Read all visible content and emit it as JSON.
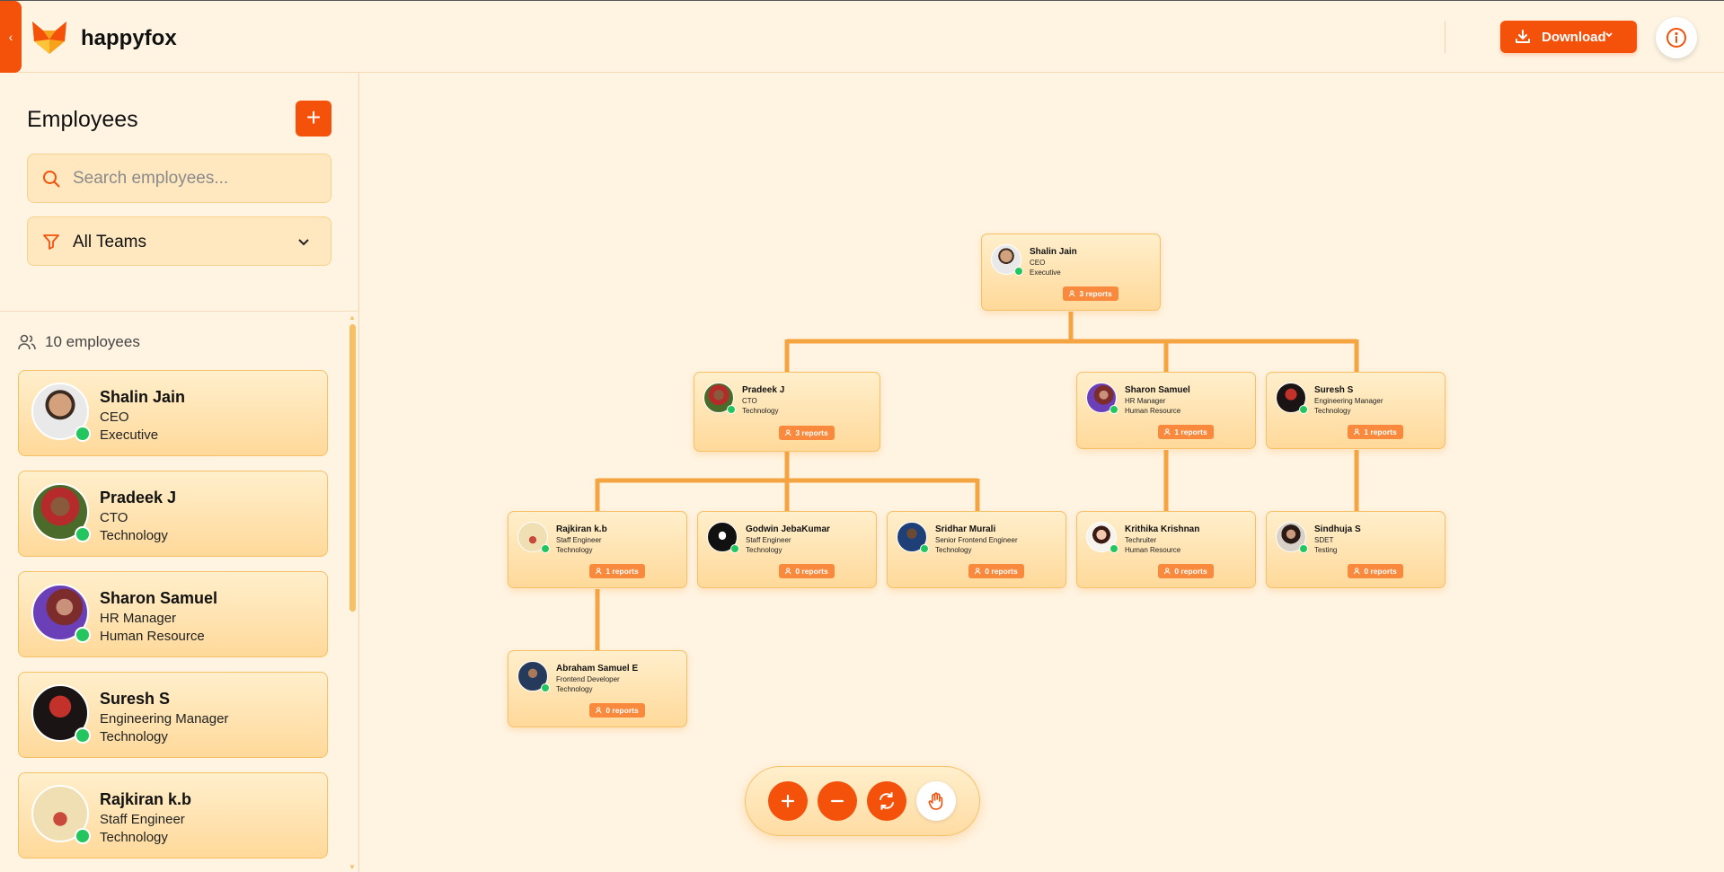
{
  "header": {
    "brand": "happyfox",
    "download_label": "Download"
  },
  "sidebar": {
    "title": "Employees",
    "search_placeholder": "Search employees...",
    "team_filter": "All Teams",
    "employee_count": "10 employees",
    "employees": [
      {
        "name": "Shalin Jain",
        "role": "CEO",
        "dept": "Executive"
      },
      {
        "name": "Pradeek J",
        "role": "CTO",
        "dept": "Technology"
      },
      {
        "name": "Sharon Samuel",
        "role": "HR Manager",
        "dept": "Human Resource"
      },
      {
        "name": "Suresh S",
        "role": "Engineering Manager",
        "dept": "Technology"
      },
      {
        "name": "Rajkiran k.b",
        "role": "Staff Engineer",
        "dept": "Technology"
      }
    ]
  },
  "org": {
    "nodes": [
      {
        "name": "Shalin Jain",
        "role": "CEO",
        "dept": "Executive",
        "reports": "3 reports"
      },
      {
        "name": "Pradeek J",
        "role": "CTO",
        "dept": "Technology",
        "reports": "3 reports"
      },
      {
        "name": "Sharon Samuel",
        "role": "HR Manager",
        "dept": "Human Resource",
        "reports": "1 reports"
      },
      {
        "name": "Suresh S",
        "role": "Engineering Manager",
        "dept": "Technology",
        "reports": "1 reports"
      },
      {
        "name": "Rajkiran k.b",
        "role": "Staff Engineer",
        "dept": "Technology",
        "reports": "1 reports"
      },
      {
        "name": "Godwin JebaKumar",
        "role": "Staff Engineer",
        "dept": "Technology",
        "reports": "0 reports"
      },
      {
        "name": "Sridhar Murali",
        "role": "Senior Frontend Engineer",
        "dept": "Technology",
        "reports": "0 reports"
      },
      {
        "name": "Krithika Krishnan",
        "role": "Techruiter",
        "dept": "Human Resource",
        "reports": "0 reports"
      },
      {
        "name": "Sindhuja S",
        "role": "SDET",
        "dept": "Testing",
        "reports": "0 reports"
      },
      {
        "name": "Abraham Samuel E",
        "role": "Frontend Developer",
        "dept": "Technology",
        "reports": "0 reports"
      }
    ]
  },
  "colors": {
    "accent": "#f4510b",
    "connector": "#f5a442",
    "online": "#22c55e"
  },
  "icons": [
    "chevron-left-icon",
    "fox-logo",
    "download-icon",
    "chevron-down-icon",
    "info-icon",
    "plus-icon",
    "search-icon",
    "filter-icon",
    "users-icon",
    "zoom-in-icon",
    "zoom-out-icon",
    "reset-icon",
    "pan-hand-icon"
  ]
}
